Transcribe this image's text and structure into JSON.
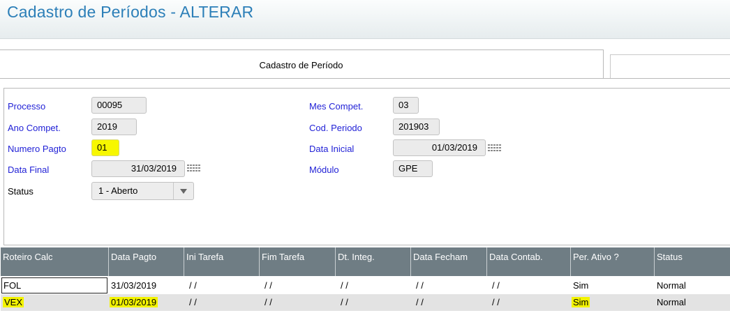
{
  "window": {
    "title": "Cadastro de Períodos - ALTERAR"
  },
  "tabs": [
    {
      "label": "Cadastro de Período"
    },
    {
      "label": ""
    }
  ],
  "form": {
    "processo": {
      "label": "Processo",
      "value": "00095"
    },
    "ano_compet": {
      "label": "Ano Compet.",
      "value": "2019"
    },
    "numero_pagto": {
      "label": "Numero Pagto",
      "value": "01"
    },
    "data_final": {
      "label": "Data Final",
      "value": "31/03/2019"
    },
    "status": {
      "label": "Status",
      "value": "1 - Aberto"
    },
    "mes_compet": {
      "label": "Mes Compet.",
      "value": "03"
    },
    "cod_periodo": {
      "label": "Cod. Periodo",
      "value": "201903"
    },
    "data_inicial": {
      "label": "Data Inicial",
      "value": "01/03/2019"
    },
    "modulo": {
      "label": "Módulo",
      "value": "GPE"
    }
  },
  "grid": {
    "columns": [
      "Roteiro Calc",
      "Data Pagto",
      "Ini Tarefa",
      "Fim Tarefa",
      "Dt. Integ.",
      "Data Fecham",
      "Data Contab.",
      "Per. Ativo ?",
      "Status"
    ],
    "rows": [
      [
        "FOL",
        "31/03/2019",
        " / /",
        " / /",
        " / /",
        " / /",
        " / /",
        "Sim",
        "Normal"
      ],
      [
        "VEX",
        "01/03/2019",
        " / /",
        " / /",
        " / /",
        " / /",
        " / /",
        "Sim",
        "Normal"
      ]
    ]
  },
  "colors": {
    "title": "#2c7fb8",
    "label": "#1f1fd6",
    "grid_header": "#6f7d84",
    "highlight": "#f7f700"
  },
  "icons": {
    "calendar": "calendar-icon",
    "dropdown": "chevron-down-icon"
  }
}
